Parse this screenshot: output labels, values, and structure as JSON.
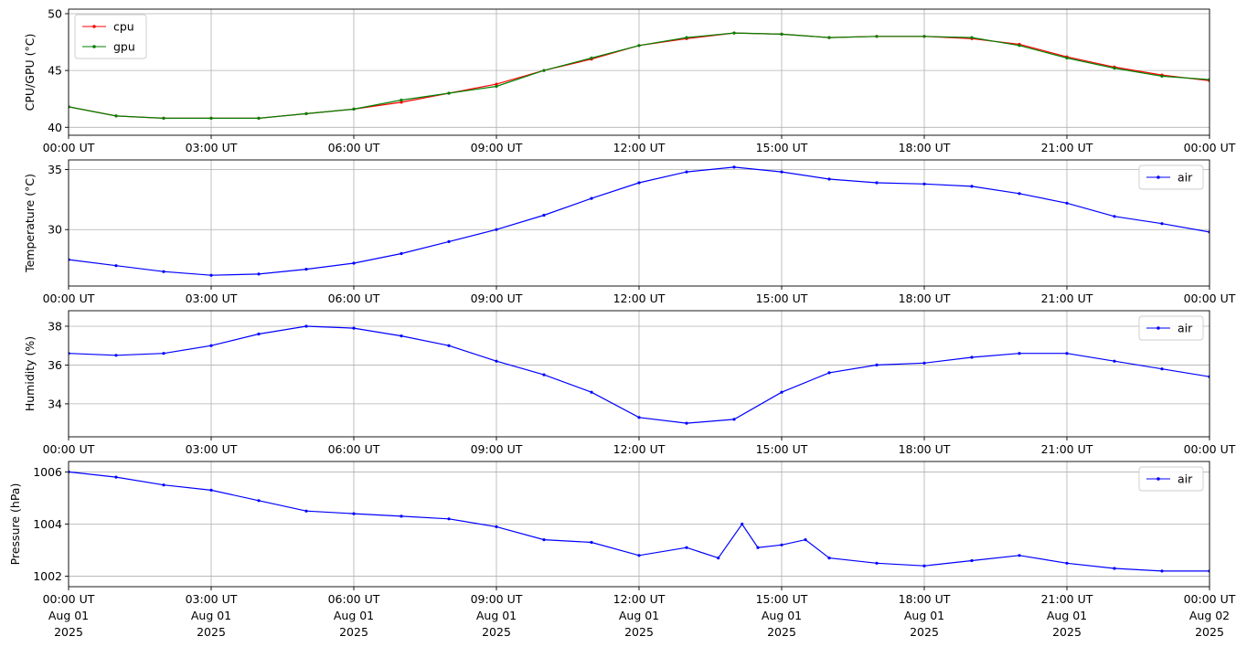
{
  "figure": {
    "background": "#ffffff",
    "grid_color": "#b0b0b0"
  },
  "x_axis": {
    "range": [
      "2025-08-01T00:00Z",
      "2025-08-02T00:00Z"
    ],
    "ticks": [
      "2025-08-01T00:00Z",
      "2025-08-01T03:00Z",
      "2025-08-01T06:00Z",
      "2025-08-01T09:00Z",
      "2025-08-01T12:00Z",
      "2025-08-01T15:00Z",
      "2025-08-01T18:00Z",
      "2025-08-01T21:00Z",
      "2025-08-02T00:00Z"
    ],
    "tick_labels": [
      "00:00 UT",
      "03:00 UT",
      "06:00 UT",
      "09:00 UT",
      "12:00 UT",
      "15:00 UT",
      "18:00 UT",
      "21:00 UT",
      "00:00 UT"
    ],
    "date_labels": [
      "Aug 01",
      "Aug 01",
      "Aug 01",
      "Aug 01",
      "Aug 01",
      "Aug 01",
      "Aug 01",
      "Aug 01",
      "Aug 02"
    ],
    "year_labels": [
      "2025",
      "2025",
      "2025",
      "2025",
      "2025",
      "2025",
      "2025",
      "2025",
      "2025"
    ]
  },
  "chart_data": [
    {
      "type": "line",
      "ylabel": "CPU/GPU (°C)",
      "ylim": [
        39.3,
        50.4
      ],
      "yticks": [
        40,
        45,
        50
      ],
      "grid": true,
      "legend_position": "top-left",
      "series": [
        {
          "name": "cpu",
          "color": "#ff0000",
          "x": [
            "2025-08-01T00:00Z",
            "2025-08-01T01:00Z",
            "2025-08-01T02:00Z",
            "2025-08-01T03:00Z",
            "2025-08-01T04:00Z",
            "2025-08-01T05:00Z",
            "2025-08-01T06:00Z",
            "2025-08-01T07:00Z",
            "2025-08-01T08:00Z",
            "2025-08-01T09:00Z",
            "2025-08-01T10:00Z",
            "2025-08-01T11:00Z",
            "2025-08-01T12:00Z",
            "2025-08-01T13:00Z",
            "2025-08-01T14:00Z",
            "2025-08-01T15:00Z",
            "2025-08-01T16:00Z",
            "2025-08-01T17:00Z",
            "2025-08-01T18:00Z",
            "2025-08-01T19:00Z",
            "2025-08-01T20:00Z",
            "2025-08-01T21:00Z",
            "2025-08-01T22:00Z",
            "2025-08-01T23:00Z",
            "2025-08-02T00:00Z"
          ],
          "y": [
            41.8,
            41.0,
            40.8,
            40.8,
            40.8,
            41.2,
            41.6,
            42.2,
            43.0,
            43.8,
            45.0,
            46.0,
            47.2,
            47.8,
            48.3,
            48.2,
            47.9,
            48.0,
            48.0,
            47.8,
            47.3,
            46.2,
            45.3,
            44.6,
            44.1
          ]
        },
        {
          "name": "gpu",
          "color": "#008000",
          "x": [
            "2025-08-01T00:00Z",
            "2025-08-01T01:00Z",
            "2025-08-01T02:00Z",
            "2025-08-01T03:00Z",
            "2025-08-01T04:00Z",
            "2025-08-01T05:00Z",
            "2025-08-01T06:00Z",
            "2025-08-01T07:00Z",
            "2025-08-01T08:00Z",
            "2025-08-01T09:00Z",
            "2025-08-01T10:00Z",
            "2025-08-01T11:00Z",
            "2025-08-01T12:00Z",
            "2025-08-01T13:00Z",
            "2025-08-01T14:00Z",
            "2025-08-01T15:00Z",
            "2025-08-01T16:00Z",
            "2025-08-01T17:00Z",
            "2025-08-01T18:00Z",
            "2025-08-01T19:00Z",
            "2025-08-01T20:00Z",
            "2025-08-01T21:00Z",
            "2025-08-01T22:00Z",
            "2025-08-01T23:00Z",
            "2025-08-02T00:00Z"
          ],
          "y": [
            41.8,
            41.0,
            40.8,
            40.8,
            40.8,
            41.2,
            41.6,
            42.4,
            43.0,
            43.6,
            45.0,
            46.1,
            47.2,
            47.9,
            48.3,
            48.2,
            47.9,
            48.0,
            48.0,
            47.9,
            47.2,
            46.1,
            45.2,
            44.5,
            44.2
          ]
        }
      ]
    },
    {
      "type": "line",
      "ylabel": "Temperature (°C)",
      "ylim": [
        25.3,
        35.8
      ],
      "yticks": [
        30,
        35
      ],
      "grid": true,
      "legend_position": "top-right",
      "series": [
        {
          "name": "air",
          "color": "#0000ff",
          "x": [
            "2025-08-01T00:00Z",
            "2025-08-01T01:00Z",
            "2025-08-01T02:00Z",
            "2025-08-01T03:00Z",
            "2025-08-01T04:00Z",
            "2025-08-01T05:00Z",
            "2025-08-01T06:00Z",
            "2025-08-01T07:00Z",
            "2025-08-01T08:00Z",
            "2025-08-01T09:00Z",
            "2025-08-01T10:00Z",
            "2025-08-01T11:00Z",
            "2025-08-01T12:00Z",
            "2025-08-01T13:00Z",
            "2025-08-01T14:00Z",
            "2025-08-01T15:00Z",
            "2025-08-01T16:00Z",
            "2025-08-01T17:00Z",
            "2025-08-01T18:00Z",
            "2025-08-01T19:00Z",
            "2025-08-01T20:00Z",
            "2025-08-01T21:00Z",
            "2025-08-01T22:00Z",
            "2025-08-01T23:00Z",
            "2025-08-02T00:00Z"
          ],
          "y": [
            27.5,
            27.0,
            26.5,
            26.2,
            26.3,
            26.7,
            27.2,
            28.0,
            29.0,
            30.0,
            31.2,
            32.6,
            33.9,
            34.8,
            35.2,
            34.8,
            34.2,
            33.9,
            33.8,
            33.6,
            33.0,
            32.2,
            31.1,
            30.5,
            29.8
          ]
        }
      ]
    },
    {
      "type": "line",
      "ylabel": "Humidity (%)",
      "ylim": [
        32.3,
        38.8
      ],
      "yticks": [
        34,
        36,
        38
      ],
      "grid": true,
      "legend_position": "top-right",
      "series": [
        {
          "name": "air",
          "color": "#0000ff",
          "x": [
            "2025-08-01T00:00Z",
            "2025-08-01T01:00Z",
            "2025-08-01T02:00Z",
            "2025-08-01T03:00Z",
            "2025-08-01T04:00Z",
            "2025-08-01T05:00Z",
            "2025-08-01T06:00Z",
            "2025-08-01T07:00Z",
            "2025-08-01T08:00Z",
            "2025-08-01T09:00Z",
            "2025-08-01T10:00Z",
            "2025-08-01T11:00Z",
            "2025-08-01T12:00Z",
            "2025-08-01T13:00Z",
            "2025-08-01T14:00Z",
            "2025-08-01T15:00Z",
            "2025-08-01T16:00Z",
            "2025-08-01T17:00Z",
            "2025-08-01T18:00Z",
            "2025-08-01T19:00Z",
            "2025-08-01T20:00Z",
            "2025-08-01T21:00Z",
            "2025-08-01T22:00Z",
            "2025-08-01T23:00Z",
            "2025-08-02T00:00Z"
          ],
          "y": [
            36.6,
            36.5,
            36.6,
            37.0,
            37.6,
            38.0,
            37.9,
            37.5,
            37.0,
            36.2,
            35.5,
            34.6,
            33.3,
            33.0,
            33.2,
            34.6,
            35.6,
            36.0,
            36.1,
            36.4,
            36.6,
            36.6,
            36.2,
            35.8,
            35.4
          ]
        }
      ]
    },
    {
      "type": "line",
      "ylabel": "Pressure (hPa)",
      "ylim": [
        1001.6,
        1006.4
      ],
      "yticks": [
        1002,
        1004,
        1006
      ],
      "grid": true,
      "legend_position": "top-right",
      "series": [
        {
          "name": "air",
          "color": "#0000ff",
          "x": [
            "2025-08-01T00:00Z",
            "2025-08-01T01:00Z",
            "2025-08-01T02:00Z",
            "2025-08-01T03:00Z",
            "2025-08-01T04:00Z",
            "2025-08-01T05:00Z",
            "2025-08-01T06:00Z",
            "2025-08-01T07:00Z",
            "2025-08-01T08:00Z",
            "2025-08-01T09:00Z",
            "2025-08-01T10:00Z",
            "2025-08-01T11:00Z",
            "2025-08-01T12:00Z",
            "2025-08-01T13:00Z",
            "2025-08-01T13:40Z",
            "2025-08-01T14:10Z",
            "2025-08-01T14:30Z",
            "2025-08-01T15:00Z",
            "2025-08-01T15:30Z",
            "2025-08-01T16:00Z",
            "2025-08-01T17:00Z",
            "2025-08-01T18:00Z",
            "2025-08-01T19:00Z",
            "2025-08-01T20:00Z",
            "2025-08-01T21:00Z",
            "2025-08-01T22:00Z",
            "2025-08-01T23:00Z",
            "2025-08-02T00:00Z"
          ],
          "y": [
            1006.0,
            1005.8,
            1005.5,
            1005.3,
            1004.9,
            1004.5,
            1004.4,
            1004.3,
            1004.2,
            1003.9,
            1003.4,
            1003.3,
            1002.8,
            1003.1,
            1002.7,
            1004.0,
            1003.1,
            1003.2,
            1003.4,
            1002.7,
            1002.5,
            1002.4,
            1002.6,
            1002.8,
            1002.5,
            1002.3,
            1002.2,
            1002.2
          ]
        }
      ]
    }
  ]
}
